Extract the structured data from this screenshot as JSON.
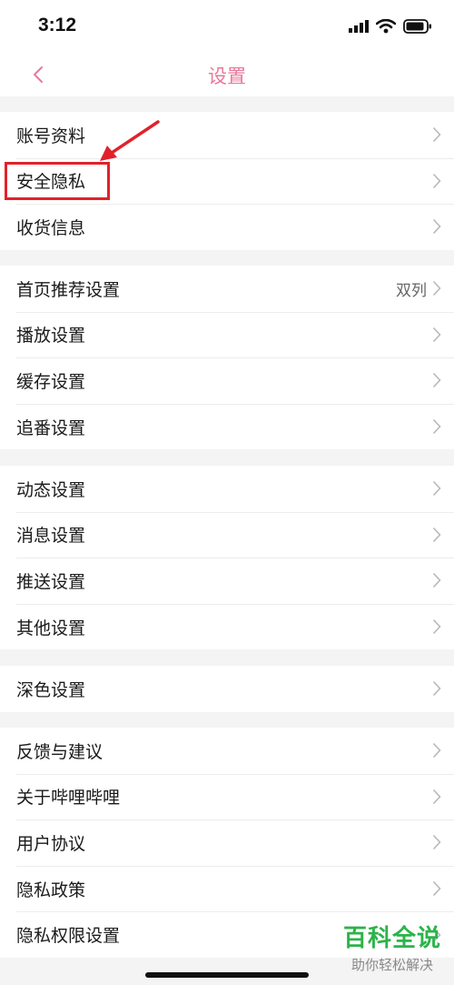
{
  "status_bar": {
    "time": "3:12"
  },
  "nav": {
    "title": "设置"
  },
  "groups": [
    {
      "items": [
        {
          "label": "账号资料"
        },
        {
          "label": "安全隐私"
        },
        {
          "label": "收货信息"
        }
      ]
    },
    {
      "items": [
        {
          "label": "首页推荐设置",
          "value": "双列"
        },
        {
          "label": "播放设置"
        },
        {
          "label": "缓存设置"
        },
        {
          "label": "追番设置"
        }
      ]
    },
    {
      "items": [
        {
          "label": "动态设置"
        },
        {
          "label": "消息设置"
        },
        {
          "label": "推送设置"
        },
        {
          "label": "其他设置"
        }
      ]
    },
    {
      "items": [
        {
          "label": "深色设置"
        }
      ]
    },
    {
      "items": [
        {
          "label": "反馈与建议"
        },
        {
          "label": "关于哔哩哔哩"
        },
        {
          "label": "用户协议"
        },
        {
          "label": "隐私政策"
        },
        {
          "label": "隐私权限设置"
        }
      ]
    }
  ],
  "watermark": {
    "title": "百科全说",
    "subtitle": "助你轻松解决"
  },
  "colors": {
    "accent": "#e8789a",
    "annotation": "#e0222b",
    "watermark": "#2db34a"
  }
}
